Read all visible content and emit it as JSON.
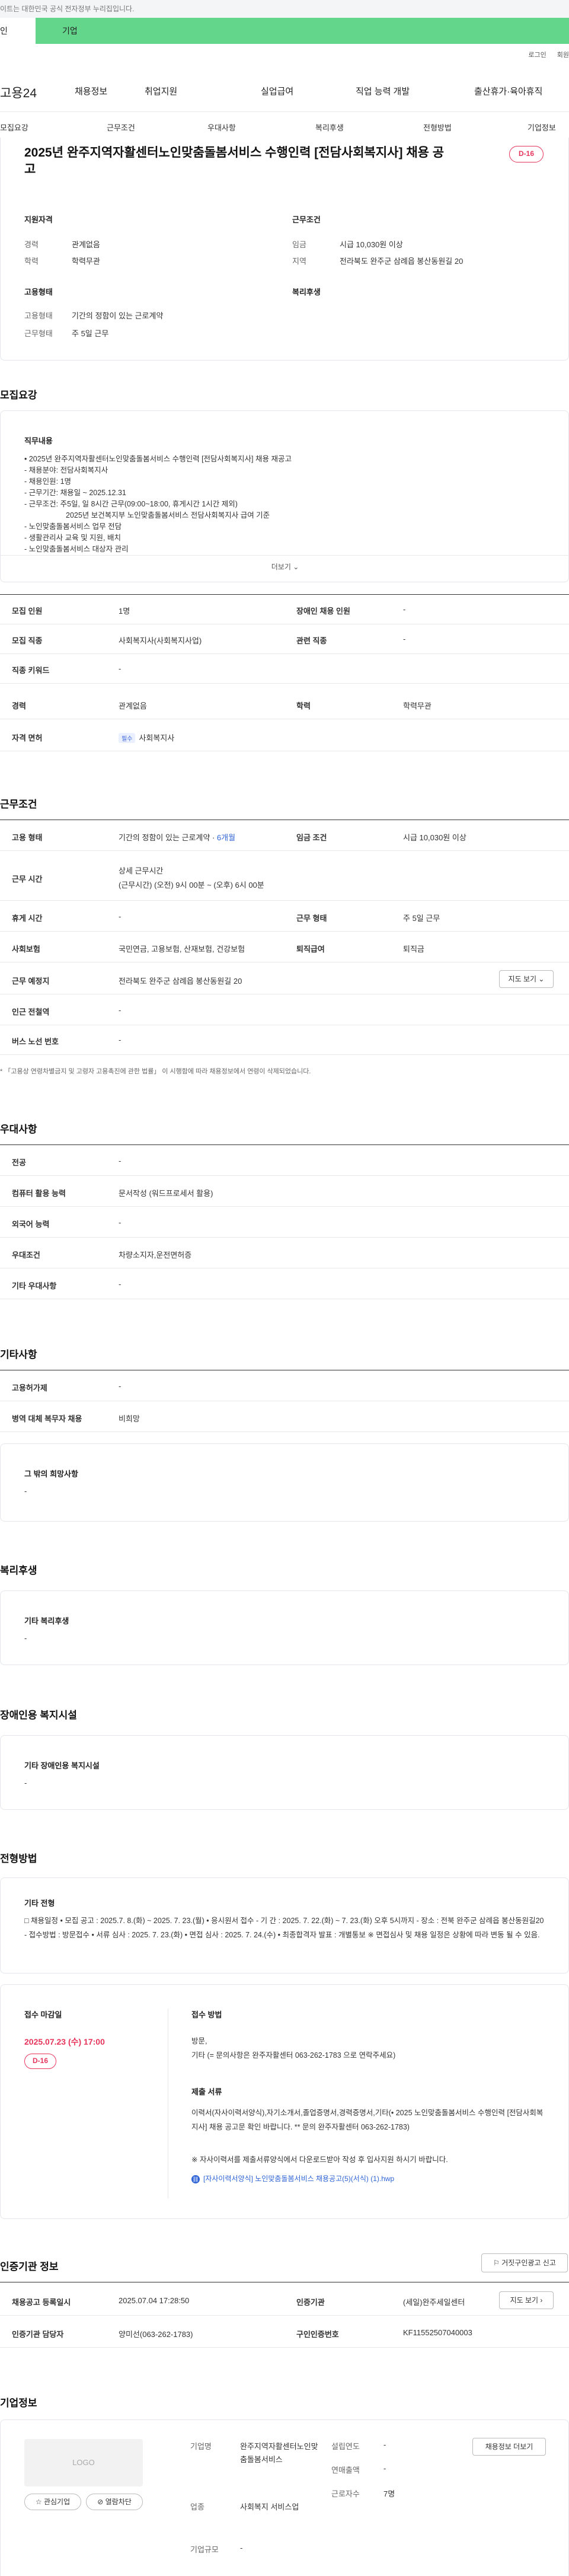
{
  "topbar": {
    "notice": "이트는 대한민국 공식 전자정부 누리집입니다."
  },
  "site_tabs": {
    "tab1": "인",
    "tab2": "기업"
  },
  "util": {
    "login": "로그인",
    "join": "회원"
  },
  "gnb": {
    "logo": "고용24",
    "menu": [
      "채용정보",
      "취업지원",
      "실업급여",
      "직업 능력 개발",
      "출산휴가·육아휴직"
    ]
  },
  "subnav": [
    "모집요강",
    "근무조건",
    "우대사항",
    "복리후생",
    "전형방법",
    "기업정보"
  ],
  "header": {
    "title": "2025년 완주지역자활센터노인맞춤돌봄서비스 수행인력 [전담사회복지사] 채용 공고",
    "dday": "D-16",
    "qual_title": "지원자격",
    "career_label": "경력",
    "career": "관계없음",
    "edu_label": "학력",
    "edu": "학력무관",
    "cond_title": "근무조건",
    "wage_label": "임금",
    "wage": "시급 10,030원 이상",
    "area_label": "지역",
    "area": "전라북도 완주군 삼례읍 봉산동원길 20",
    "emp_title": "고용형태",
    "emp_type_label": "고용형태",
    "emp_type": "기간의 정함이 있는 근로계약",
    "work_type_label": "근무형태",
    "work_type": "주 5일 근무",
    "welfare_title": "복리후생"
  },
  "recruit": {
    "title": "모집요강",
    "duty_title": "직무내용",
    "duty_lines": [
      "• 2025년 완주지역자활센터노인맞춤돌봄서비스 수행인력 [전담사회복지사] 채용 재공고",
      "- 채용분야: 전담사회복지사",
      "- 채용인원: 1명",
      "- 근무기간: 채용일 ~ 2025.12.31",
      "- 근무조건: 주5일, 일 8시간 근무(09:00~18:00, 휴게시간 1시간 제외)",
      "2025년 보건복지부 노인맞춤돌봄서비스 전담사회복지사 급여 기준",
      "- 노인맞춤돌봄서비스 업무 전담",
      "- 생활관리사 교육 및 지원, 배치",
      "- 노인맞춤돌봄서비스 대상자 관리"
    ],
    "more": "더보기",
    "rows": [
      {
        "l1": "모집 인원",
        "v1": "1명",
        "l2": "장애인 채용 인원",
        "v2": "-"
      },
      {
        "l1": "모집 직종",
        "v1": "사회복지사(사회복지사업)",
        "l2": "관련 직종",
        "v2": "-"
      },
      {
        "l1": "직종 키워드",
        "v1": "-",
        "l2": "",
        "v2": ""
      },
      {
        "l1": "경력",
        "v1": "관계없음",
        "l2": "학력",
        "v2": "학력무관"
      },
      {
        "l1": "자격 면허",
        "v1": "사회복지사",
        "l2": "",
        "v2": ""
      }
    ],
    "license_tag": "필수"
  },
  "work": {
    "title": "근무조건",
    "emp_label": "고용 형태",
    "emp_val": "기간의 정함이 있는 근로계약 · ",
    "emp_months": "6개월",
    "wage_label": "임금 조건",
    "wage_val": "시급 10,030원 이상",
    "time_label": "근무 시간",
    "time_1": "상세 근무시간",
    "time_2": "(근무시간) (오전) 9시 00분 ~ (오후) 6시 00분",
    "rest_label": "휴게 시간",
    "rest_val": "-",
    "form_label": "근무 형태",
    "form_val": "주 5일 근무",
    "ins_label": "사회보험",
    "ins_val": "국민연금, 고용보험, 산재보험, 건강보험",
    "sev_label": "퇴직급여",
    "sev_val": "퇴직금",
    "place_label": "근무 예정지",
    "place_val": "전라북도 완주군 삼례읍 봉산동원길 20",
    "map_btn": "지도 보기",
    "subway_label": "인근 전철역",
    "subway_val": "-",
    "bus_label": "버스 노선 번호",
    "bus_val": "-",
    "footnote": "* 「고용상 연령차별금지 및 고령자 고용촉진에 관한 법률」 이 시행함에 따라 채용정보에서 연령이 삭제되었습니다."
  },
  "pref": {
    "title": "우대사항",
    "rows": [
      {
        "l": "전공",
        "v": "-"
      },
      {
        "l": "컴퓨터 활용 능력",
        "v": "문서작성 (워드프로세서 활용)"
      },
      {
        "l": "외국어 능력",
        "v": "-"
      },
      {
        "l": "우대조건",
        "v": "차량소지자,운전면허증"
      },
      {
        "l": "기타 우대사항",
        "v": "-"
      }
    ]
  },
  "etc": {
    "title": "기타사항",
    "rows": [
      {
        "l": "고용허가제",
        "v": "-"
      },
      {
        "l": "병역 대체 복무자 채용",
        "v": "비희망"
      }
    ],
    "other_title": "그 밖의 희망사항",
    "other_val": "-"
  },
  "welfare": {
    "title": "복리후생",
    "sub": "기타 복리후생",
    "val": "-"
  },
  "disab": {
    "title": "장애인용 복지시설",
    "sub": "기타 장애인용 복지시설",
    "val": "-"
  },
  "screen": {
    "title": "전형방법",
    "sub": "기타 전형",
    "body": "□ 채용일정 • 모집 공고 : 2025.7. 8.(화) ~ 2025. 7. 23.(월) • 응시원서 접수 - 기 간 : 2025. 7. 22.(화) ~ 7. 23.(화) 오후 5시까지 - 장소 : 전북 완주군 삼례읍 봉산동원길20 - 접수방법 : 방문접수 • 서류 심사 : 2025. 7. 23.(화) • 면접 심사 : 2025. 7. 24.(수) • 최종합격자 발표 : 개별통보 ※ 면접심사 및 채용 일정은 상황에 따라 변동 될 수 있음.",
    "deadline_label": "접수 마감일",
    "deadline": "2025.07.23 (수) 17:00",
    "dday": "D-16",
    "method_label": "접수 방법",
    "method_1": "방문,",
    "method_2": "기타 (= 문의사항은 완주자활센터 063-262-1783 으로 연락주세요)",
    "docs_label": "제출 서류",
    "docs_text": "이력서(자사이력서양식),자기소개서,졸업증명서,경력증명서,기타(• 2025 노인맞춤돌봄서비스 수행인력 [전담사회복지사] 채용 공고문 확인 바랍니다. ** 문의 완주자활센터 063-262-1783)",
    "docs_note": "※ 자사이력서를 제출서류양식에서 다운로드받아 작성 후 입사지원 하시기 바랍니다.",
    "file_link": "[자사이력서양식] 노인맞춤돌봄서비스 채용공고(5)(서식) (1).hwp"
  },
  "cert": {
    "title": "인증기관 정보",
    "report_btn": "거짓구인광고 신고",
    "reg_label": "채용공고 등록일시",
    "reg_val": "2025.07.04 17:28:50",
    "org_label": "인증기관",
    "org_val": "(세일)완주세일센터",
    "map_btn": "지도 보기",
    "mgr_label": "인증기관 담당자",
    "mgr_val": "양미선(063-262-1783)",
    "num_label": "구인인증번호",
    "num_val": "KF11552507040003"
  },
  "company": {
    "title": "기업정보",
    "logo": "LOGO",
    "fav_btn": "관심기업",
    "block_btn": "열람차단",
    "name_label": "기업명",
    "name_val": "완주지역자활센터노인맞춤돌봄서비스",
    "ind_label": "업종",
    "ind_val": "사회복지 서비스업",
    "size_label": "기업규모",
    "size_val": "-",
    "year_label": "설립연도",
    "year_val": "-",
    "sales_label": "연매출액",
    "sales_val": "-",
    "emp_label": "근로자수",
    "emp_val": "7명",
    "jobs_btn": "채용정보 더보기"
  }
}
